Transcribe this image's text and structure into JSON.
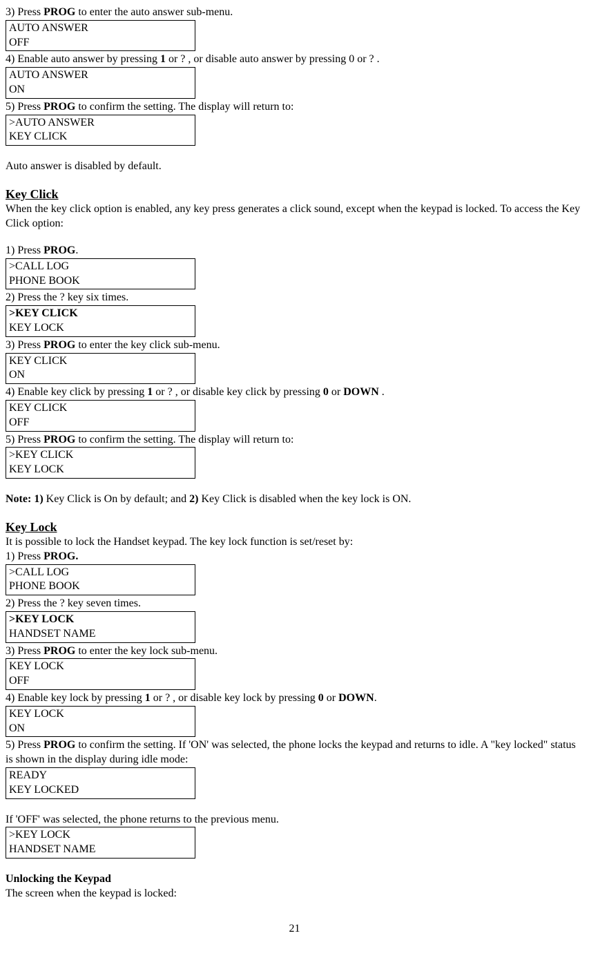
{
  "autoAnswer": {
    "step3": {
      "before": "3) Press ",
      "key": "PROG",
      "after": " to enter the auto answer sub-menu."
    },
    "display1": {
      "l1": "AUTO ANSWER",
      "l2": "OFF"
    },
    "step4": {
      "before": "4) Enable auto answer by pressing ",
      "k1": "1",
      "mid1": " or ?   , or disable auto answer by pressing 0 or ?   ."
    },
    "display2": {
      "l1": "AUTO ANSWER",
      "l2": "ON"
    },
    "step5": {
      "before": "5) Press ",
      "key": "PROG",
      "after": " to confirm the setting.  The display will return to:"
    },
    "display3": {
      "l1": ">AUTO ANSWER",
      "l2": " KEY CLICK"
    },
    "note": "Auto answer is disabled by default."
  },
  "keyClick": {
    "heading": "Key Click",
    "intro": "When the key click option is enabled, any key press generates a click sound, except when the keypad is locked. To access the Key Click option:",
    "step1": {
      "before": "1) Press ",
      "key": "PROG",
      "after": "."
    },
    "display1": {
      "l1": ">CALL LOG",
      "l2": " PHONE BOOK"
    },
    "step2": "2) Press the ?    key six times.",
    "display2": {
      "l1": ">KEY CLICK",
      "l2": " KEY LOCK"
    },
    "step3": {
      "before": "3) Press ",
      "key": "PROG",
      "after": " to enter the key click sub-menu."
    },
    "display3": {
      "l1": "KEY CLICK",
      "l2": "ON"
    },
    "step4": {
      "before": "4) Enable key click by pressing ",
      "k1": "1",
      "mid": " or ?  , or disable key click by pressing ",
      "k2": "0",
      "mid2": " or ",
      "k3": "DOWN",
      "after": " ."
    },
    "display4": {
      "l1": "KEY CLICK",
      "l2": "OFF"
    },
    "step5": {
      "before": "5) Press ",
      "key": "PROG",
      "after": " to confirm the setting.  The display will return to:"
    },
    "display5": {
      "l1": ">KEY CLICK",
      "l2": " KEY LOCK"
    },
    "note": {
      "bold1": "Note: 1)",
      "t1": " Key Click is On by default; and ",
      "bold2": "2)",
      "t2": " Key Click is disabled when the key lock is ON."
    }
  },
  "keyLock": {
    "heading": "Key Lock",
    "intro": "It is possible to lock the Handset keypad. The key lock function is set/reset by:",
    "step1": {
      "before": "1) Press ",
      "key": "PROG."
    },
    "display1": {
      "l1": ">CALL LOG",
      "l2": " PHONE BOOK"
    },
    "step2": "2) Press the ?    key seven times.",
    "display2": {
      "l1": ">KEY LOCK",
      "l2": " HANDSET NAME"
    },
    "step3": {
      "before": "3) Press ",
      "key": "PROG",
      "after": " to enter the key lock sub-menu."
    },
    "display3": {
      "l1": "KEY LOCK",
      "l2": "OFF"
    },
    "step4": {
      "before": "4) Enable key lock by pressing ",
      "k1": "1",
      "mid": " or ?  , or disable key lock by pressing ",
      "k2": "0",
      "mid2": " or ",
      "k3": "DOWN",
      "after": "."
    },
    "display4": {
      "l1": "KEY LOCK",
      "l2": "ON"
    },
    "step5": {
      "before": "5) Press ",
      "key": "PROG",
      "after": " to confirm the setting. If 'ON' was selected, the phone locks the keypad and returns to idle. A \"key locked\" status is shown in the display during idle mode:"
    },
    "display5": {
      "l1": "READY",
      "l2": "KEY LOCKED"
    },
    "offNote": "If 'OFF' was selected, the phone returns to the previous menu.",
    "display6": {
      "l1": ">KEY LOCK",
      "l2": " HANDSET NAME"
    }
  },
  "unlock": {
    "heading": "Unlocking the Keypad",
    "text": "The screen when the keypad is locked:"
  },
  "pageNum": "21"
}
